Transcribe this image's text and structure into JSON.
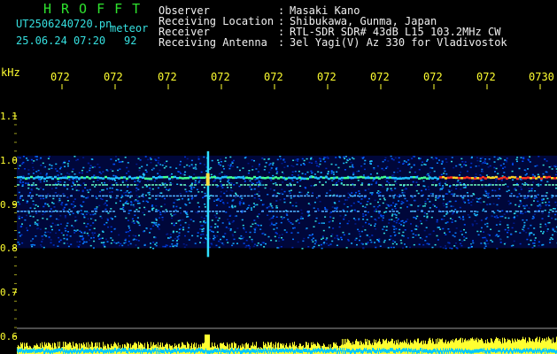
{
  "header": {
    "title": "HROFFT",
    "file": "UT2506240720.pn",
    "type": "meteor",
    "datetime": "25.06.24 07:20",
    "count": "92",
    "fields": [
      {
        "label": "Observer",
        "value": "Masaki Kano"
      },
      {
        "label": "Receiving Location",
        "value": "Shibukawa, Gunma, Japan"
      },
      {
        "label": "Receiver",
        "value": "RTL-SDR SDR# 43dB L15 103.2MHz CW"
      },
      {
        "label": "Receiving Antenna",
        "value": "3el Yagi(V) Az 330 for Vladivostok"
      }
    ],
    "separator": ":"
  },
  "axis": {
    "unit": "kHz",
    "x_ticks": [
      "072",
      "072",
      "072",
      "072",
      "072",
      "072",
      "072",
      "072",
      "072",
      "0730"
    ],
    "y_ticks": [
      "1.1",
      "1.0",
      "0.9",
      "0.8",
      "0.7",
      "0.6"
    ]
  },
  "colors": {
    "background": "#000000",
    "title": "#2ee22e",
    "file_info": "#36e0e0",
    "header_text": "#f0f0f0",
    "axis_text": "#ffff30",
    "bar_yellow": "#ffff30",
    "bar_cyan": "#00c8ff"
  },
  "signal": {
    "band_top_khz": 1.01,
    "band_bottom_khz": 0.8,
    "carrier_khz": 0.96,
    "meteor_trail_x_fraction": 0.37
  }
}
